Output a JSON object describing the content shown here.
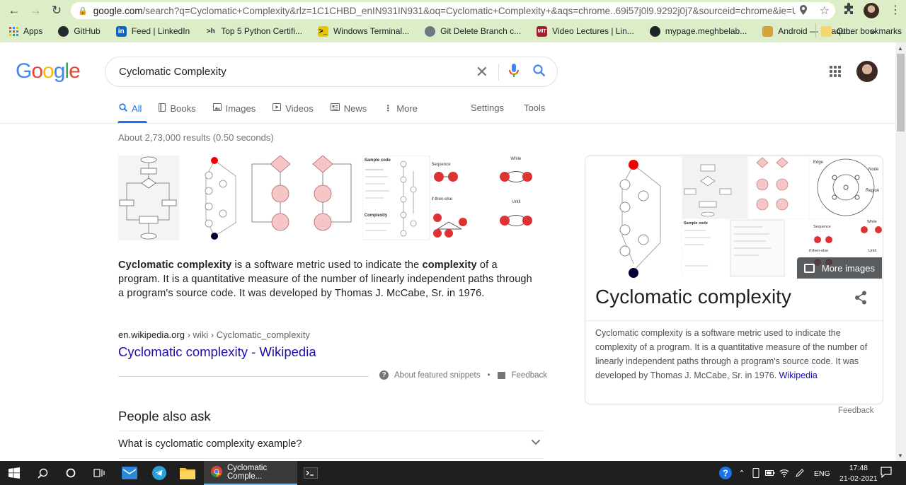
{
  "browser": {
    "url_host": "google.com",
    "url_path": "/search?q=Cyclomatic+Complexity&rlz=1C1CHBD_enIN931IN931&oq=Cyclomatic+Complexity+&aqs=chrome..69i57j0l9.9292j0j7&sourceid=chrome&ie=UT...",
    "bookmarks": [
      {
        "label": "Apps",
        "icon": "apps-icon",
        "color": "#4285f4"
      },
      {
        "label": "GitHub",
        "icon": "github-icon",
        "color": "#24292e"
      },
      {
        "label": "Feed | LinkedIn",
        "icon": "linkedin-icon",
        "color": "#0a66c2"
      },
      {
        "label": "Top 5 Python Certifi...",
        "icon": "hackerrank-icon",
        "color": "#2b2b2b"
      },
      {
        "label": "Windows Terminal...",
        "icon": "terminal-icon",
        "color": "#e8c500"
      },
      {
        "label": "Git Delete Branch c...",
        "icon": "github-icon",
        "color": "#24292e"
      },
      {
        "label": "Video Lectures | Lin...",
        "icon": "mit-icon",
        "color": "#a31f34"
      },
      {
        "label": "mypage.meghbelab...",
        "icon": "globe-icon",
        "color": "#202124"
      },
      {
        "label": "Android — Chaquo...",
        "icon": "android-icon",
        "color": "#d7a23a"
      }
    ],
    "bookmarks_overflow": "»",
    "other_bookmarks": "Other bookmarks"
  },
  "google": {
    "logo_letters": [
      "G",
      "o",
      "o",
      "g",
      "l",
      "e"
    ],
    "query": "Cyclomatic Complexity",
    "tabs": [
      {
        "label": "All",
        "icon": "search-icon",
        "active": true
      },
      {
        "label": "Books",
        "icon": "book-icon"
      },
      {
        "label": "Images",
        "icon": "image-icon"
      },
      {
        "label": "Videos",
        "icon": "video-icon"
      },
      {
        "label": "News",
        "icon": "news-icon"
      },
      {
        "label": "More",
        "icon": "more-vert-icon"
      }
    ],
    "settings_label": "Settings",
    "tools_label": "Tools",
    "results_count": "About 2,73,000 results (0.50 seconds)"
  },
  "featured_snippet": {
    "text_parts": [
      {
        "b": "Cyclomatic complexity"
      },
      {
        "t": " is a software metric used to indicate the "
      },
      {
        "b": "complexity"
      },
      {
        "t": " of a program. It is a quantitative measure of the number of linearly independent paths through a program's source code. It was developed by Thomas J. McCabe, Sr. in 1976."
      }
    ],
    "cite_host": "en.wikipedia.org",
    "cite_path": " › wiki › Cyclomatic_complexity",
    "link_title": "Cyclomatic complexity - Wikipedia",
    "about_label": "About featured snippets",
    "separator": "•",
    "feedback_label": "Feedback",
    "image_labels": [
      "Sample code",
      "Complexity",
      "Sequence",
      "if-then-else",
      "While",
      "Until"
    ]
  },
  "people_also_ask": {
    "title": "People also ask",
    "questions": [
      "What is cyclomatic complexity example?"
    ]
  },
  "knowledge_panel": {
    "title": "Cyclomatic complexity",
    "more_images": "More images",
    "description": "Cyclomatic complexity is a software metric used to indicate the complexity of a program. It is a quantitative measure of the number of linearly independent paths through a program's source code. It was developed by Thomas J. McCabe, Sr. in 1976. ",
    "source_link": "Wikipedia",
    "feedback": "Feedback",
    "image_labels": [
      "Edge",
      "Node",
      "Region",
      "Sample code",
      "Sequence",
      "if-then-else",
      "While",
      "Until"
    ]
  },
  "taskbar": {
    "chrome_label": "Cyclomatic Comple...",
    "language": "ENG",
    "time": "17:48",
    "date": "21-02-2021"
  }
}
